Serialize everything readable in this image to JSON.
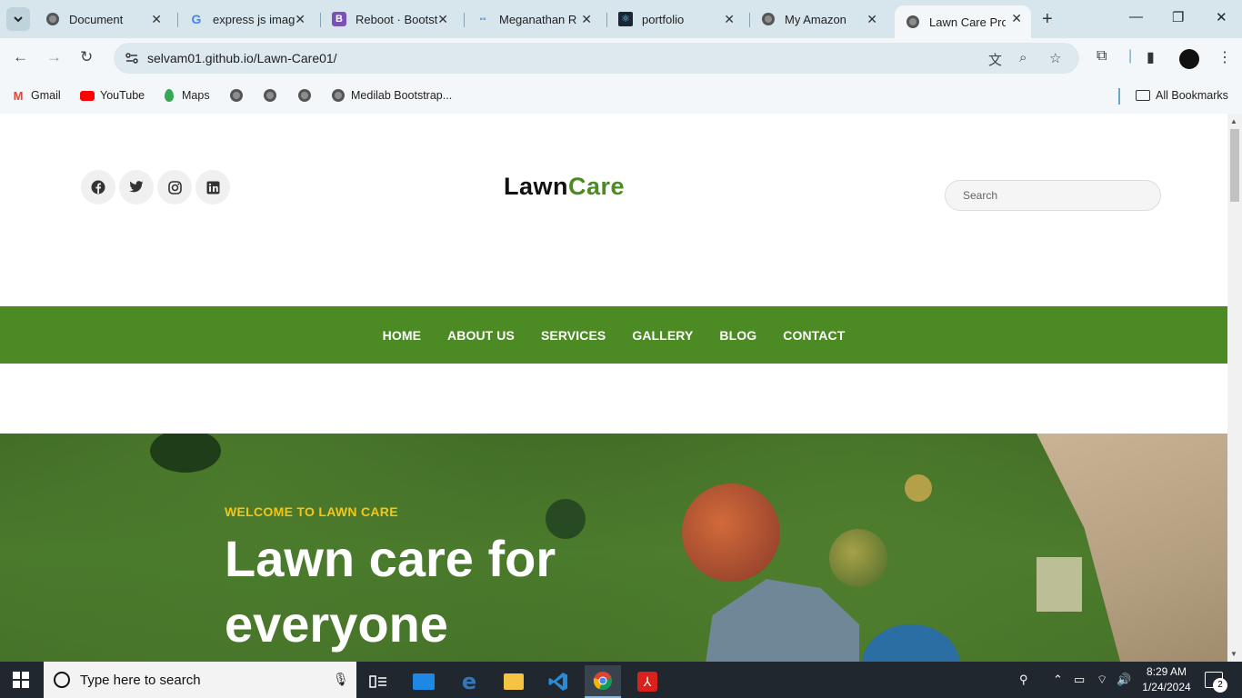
{
  "browser": {
    "tabs": [
      {
        "label": "Document",
        "active": false
      },
      {
        "label": "express js imag",
        "active": false
      },
      {
        "label": "Reboot · Bootst",
        "active": false
      },
      {
        "label": "Meganathan R",
        "active": false
      },
      {
        "label": "portfolio",
        "active": false
      },
      {
        "label": "My Amazon",
        "active": false
      },
      {
        "label": "Lawn Care Proj",
        "active": true
      }
    ],
    "url": "selvam01.github.io/Lawn-Care01/",
    "bookmarks": [
      {
        "label": "Gmail",
        "icon": "gmail-icon"
      },
      {
        "label": "YouTube",
        "icon": "youtube-icon"
      },
      {
        "label": "Maps",
        "icon": "maps-icon"
      },
      {
        "label": "",
        "icon": "globe-icon"
      },
      {
        "label": "",
        "icon": "globe-icon"
      },
      {
        "label": "",
        "icon": "globe-icon"
      },
      {
        "label": "Medilab Bootstrap...",
        "icon": "globe-icon"
      }
    ],
    "all_bookmarks": "All Bookmarks"
  },
  "site": {
    "logo_part1": "Lawn",
    "logo_part2": "Care",
    "search_placeholder": "Search",
    "social": [
      {
        "name": "facebook-icon",
        "glyph": "f"
      },
      {
        "name": "twitter-icon",
        "glyph": "t"
      },
      {
        "name": "instagram-icon",
        "glyph": "◎"
      },
      {
        "name": "linkedin-icon",
        "glyph": "in"
      }
    ],
    "nav": [
      "HOME",
      "ABOUT US",
      "SERVICES",
      "GALLERY",
      "BLOG",
      "CONTACT"
    ],
    "hero": {
      "subtitle": "WELCOME TO LAWN CARE",
      "title": "Lawn care for everyone"
    },
    "colors": {
      "brand_green": "#4c8a24",
      "accent_yellow": "#f5c518"
    }
  },
  "taskbar": {
    "search_placeholder": "Type here to search",
    "time": "8:29 AM",
    "date": "1/24/2024",
    "notification_count": "2"
  }
}
